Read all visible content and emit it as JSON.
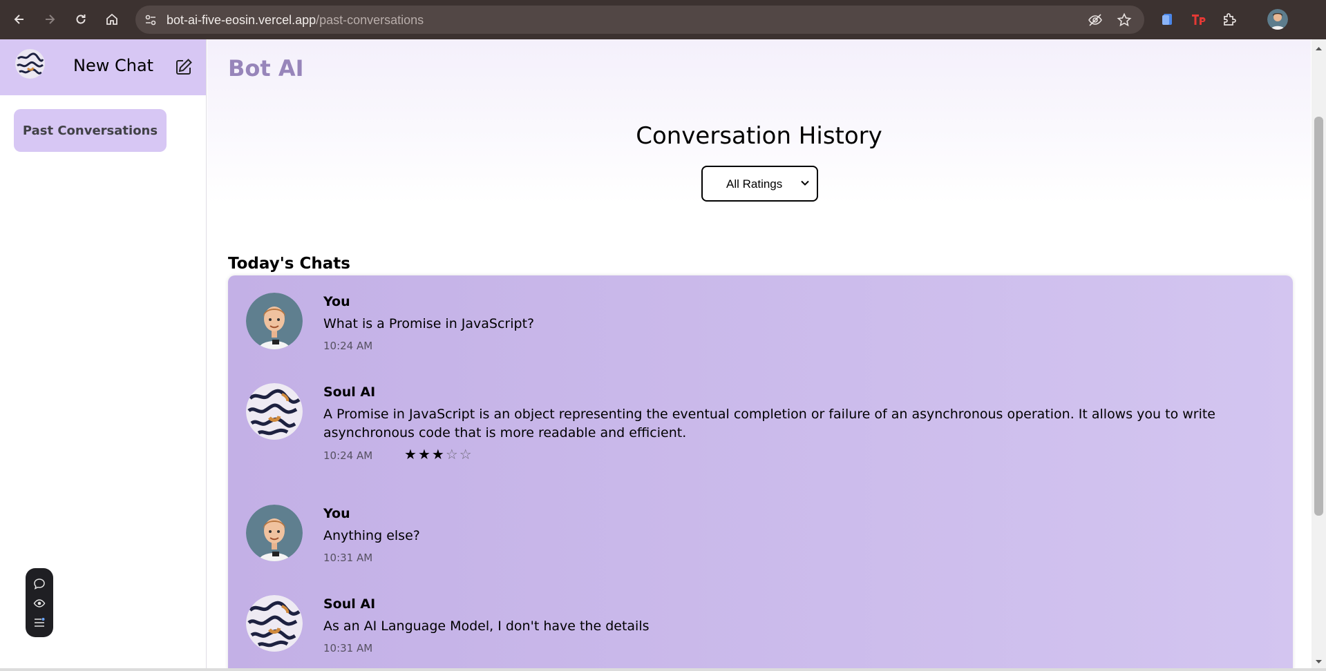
{
  "browser": {
    "url_host": "bot-ai-five-eosin.vercel.app",
    "url_path": "/past-conversations"
  },
  "sidebar": {
    "new_chat_label": "New Chat",
    "past_conversations_label": "Past Conversations"
  },
  "main": {
    "brand": "Bot AI",
    "title": "Conversation History",
    "filter": {
      "selected": "All Ratings"
    },
    "section_title": "Today's Chats",
    "messages": [
      {
        "sender": "You",
        "text": "What is a Promise in JavaScript?",
        "time": "10:24 AM"
      },
      {
        "sender": "Soul AI",
        "text": "A Promise in JavaScript is an object representing the eventual completion or failure of an asynchronous operation. It allows you to write asynchronous code that is more readable and efficient.",
        "time": "10:24 AM",
        "rating": 3,
        "rating_max": 5
      },
      {
        "sender": "You",
        "text": "Anything else?",
        "time": "10:31 AM"
      },
      {
        "sender": "Soul AI",
        "text": "As an AI Language Model, I don't have the details",
        "time": "10:31 AM"
      }
    ]
  },
  "colors": {
    "accent": "#d7c7f4",
    "brand_text": "#9785ba",
    "panel_start": "#c3b0e6",
    "panel_end": "#d3c5f0"
  }
}
